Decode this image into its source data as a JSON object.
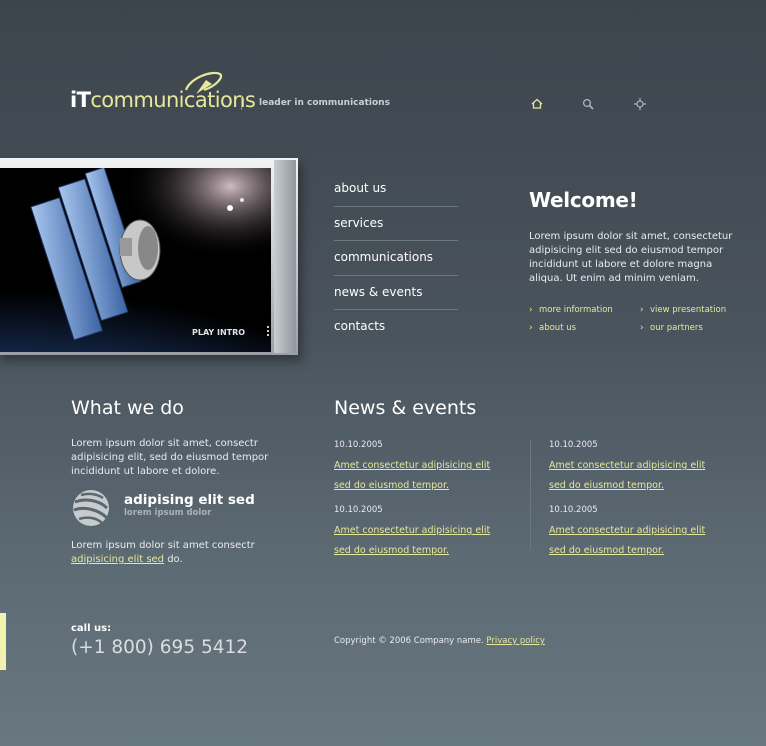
{
  "header": {
    "logo_it": "iT",
    "logo_text": "communications",
    "tagline": "leader in communications",
    "icons": [
      "home-icon",
      "search-icon",
      "sitemap-icon"
    ]
  },
  "banner": {
    "play_label": "PLAY INTRO"
  },
  "nav": {
    "items": [
      "about us",
      "services",
      "communications",
      "news & events",
      "contacts"
    ]
  },
  "welcome": {
    "title": "Welcome!",
    "text": "Lorem ipsum dolor sit amet, consectetur adipisicing elit sed do eiusmod tempor incididunt ut labore et dolore magna aliqua. Ut enim ad minim veniam.",
    "links": [
      "more information",
      "view presentation",
      "about us",
      "our partners"
    ]
  },
  "what_we_do": {
    "title": "What we do",
    "text": "Lorem ipsum dolor sit amet, consectr adipisicing elit, sed do eiusmod tempor incididunt ut labore et dolore.",
    "promo_title": "adipising elit sed",
    "promo_sub": "lorem ipsum dolor",
    "text2_before": "Lorem ipsum dolor sit amet consectr",
    "text2_link": "adipisicing elit sed",
    "text2_after": " do."
  },
  "news": {
    "title": "News & events",
    "items": [
      {
        "date": "10.10.2005",
        "text": "Amet consectetur adipisicing elit sed do eiusmod tempor."
      },
      {
        "date": "10.10.2005",
        "text": "Amet consectetur adipisicing elit sed do eiusmod tempor."
      },
      {
        "date": "10.10.2005",
        "text": "Amet consectetur adipisicing elit sed do eiusmod tempor."
      },
      {
        "date": "10.10.2005",
        "text": "Amet consectetur adipisicing elit sed do eiusmod tempor."
      }
    ]
  },
  "footer": {
    "call_label": "call us:",
    "phone": "(+1 800) 695 5412",
    "copyright": "Copyright © 2006 Company name.",
    "privacy": "Privacy policy"
  },
  "colors": {
    "accent": "#e6e89a",
    "text": "#e8ecee",
    "background": "#4a545d"
  }
}
